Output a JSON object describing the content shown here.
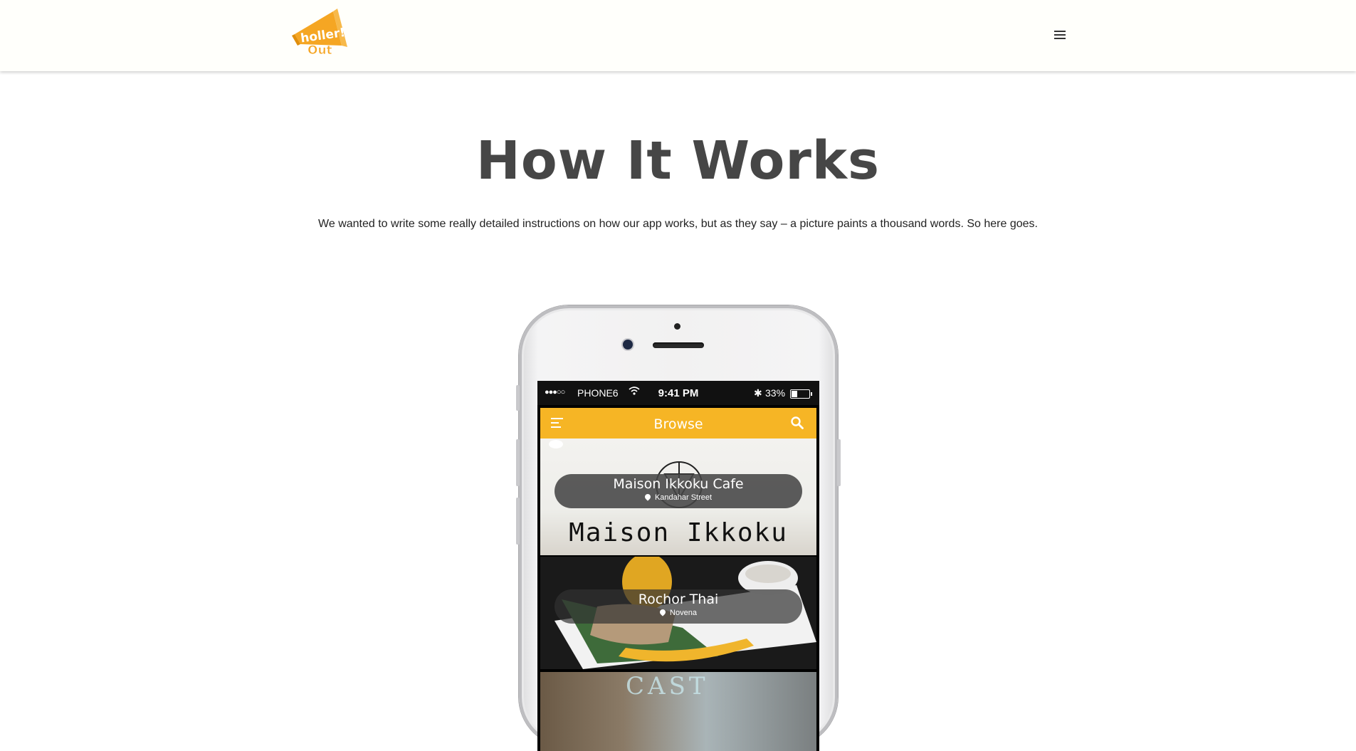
{
  "header": {
    "logo_text": "holler! out",
    "menu_icon": "hamburger-icon"
  },
  "main": {
    "title": "How It Works",
    "intro": "We wanted to write some really detailed instructions on how our app works, but as they say – a picture paints a thousand words. So here goes."
  },
  "phone": {
    "status": {
      "signal": "●●●○○",
      "carrier": "PHONE6",
      "time": "9:41 PM",
      "battery": "33%",
      "battery_level": 0.33
    },
    "app_bar": {
      "title": "Browse",
      "color": "#f6b525"
    },
    "cards": [
      {
        "name": "Maison Ikkoku Cafe",
        "location": "Kandahar Street",
        "sign": "Maison Ikkoku"
      },
      {
        "name": "Rochor Thai",
        "location": "Novena"
      },
      {
        "partial_text": "CAST"
      }
    ]
  }
}
